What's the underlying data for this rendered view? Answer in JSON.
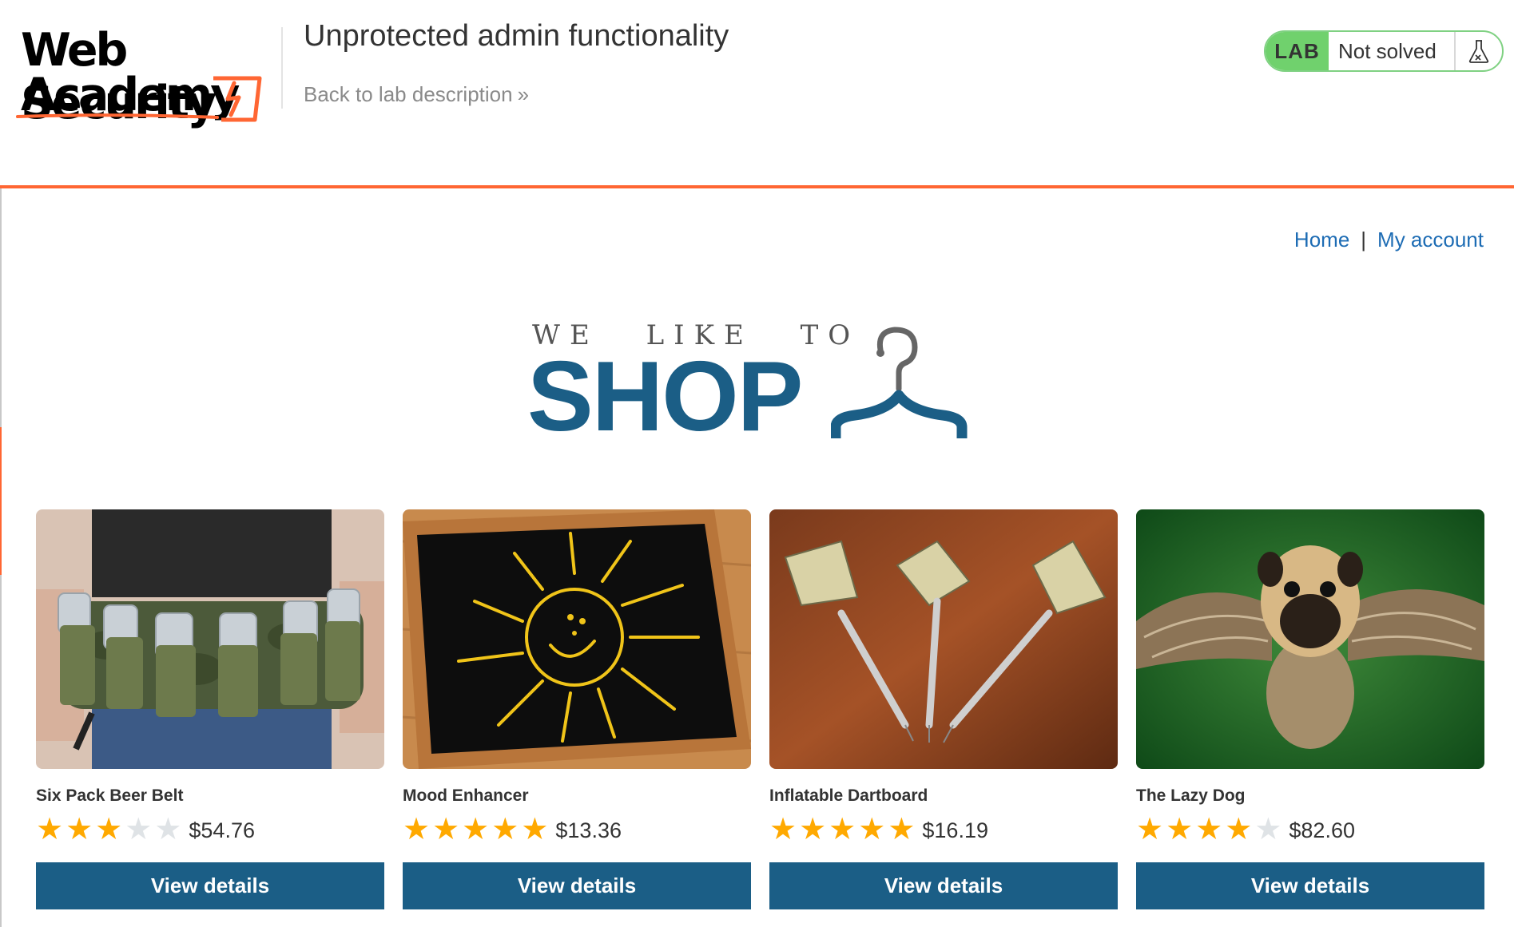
{
  "header": {
    "logo_line1": "Web Security",
    "logo_line2": "Academy",
    "lab_title": "Unprotected admin functionality",
    "back_link": "Back to lab description",
    "back_chevron": "»",
    "lab_badge": "LAB",
    "lab_status": "Not solved",
    "lab_icon": "flask-icon",
    "accent_color": "#ff6633",
    "status_color": "#70d16d"
  },
  "nav": {
    "home": "Home",
    "separator": "|",
    "account": "My account"
  },
  "banner": {
    "small_text": "WE LIKE TO",
    "big_text": "SHOP",
    "icon": "hanger-icon",
    "color": "#1b5e86"
  },
  "products": [
    {
      "name": "Six Pack Beer Belt",
      "price": "$54.76",
      "rating": 3,
      "max_rating": 5,
      "button": "View details",
      "image": "beer-belt-image"
    },
    {
      "name": "Mood Enhancer",
      "price": "$13.36",
      "rating": 5,
      "max_rating": 5,
      "button": "View details",
      "image": "chalkboard-sun-image"
    },
    {
      "name": "Inflatable Dartboard",
      "price": "$16.19",
      "rating": 5,
      "max_rating": 5,
      "button": "View details",
      "image": "darts-image"
    },
    {
      "name": "The Lazy Dog",
      "price": "$82.60",
      "rating": 4,
      "max_rating": 5,
      "button": "View details",
      "image": "flying-pug-image"
    }
  ],
  "colors": {
    "link": "#1d6cb4",
    "button": "#1b5e86",
    "star_on": "#ffa900",
    "star_off": "#dfe3e6"
  }
}
